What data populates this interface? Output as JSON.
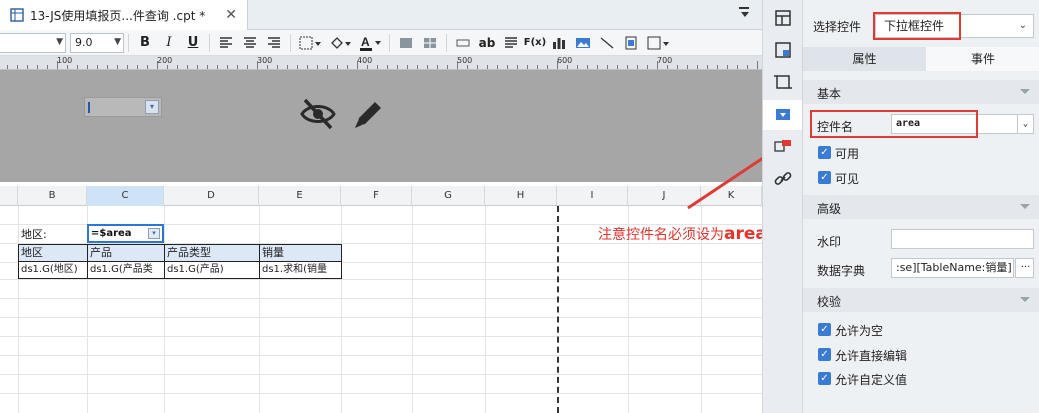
{
  "tab": {
    "title": "13-JS使用填报页...件查询 .cpt *",
    "close": "✕"
  },
  "toolbar": {
    "font_name": "",
    "font_size": "9.0",
    "bold": "B",
    "italic": "I",
    "underline": "U",
    "text_style": "ab",
    "formula": "F(x)"
  },
  "ruler": {
    "marks": [
      "100",
      "200",
      "300",
      "400",
      "500",
      "600",
      "700"
    ]
  },
  "columns": [
    "B",
    "C",
    "D",
    "E",
    "F",
    "G",
    "H",
    "I",
    "J",
    "K"
  ],
  "sheet": {
    "label_region": "地区:",
    "param_cell": "=$area",
    "headers": [
      "地区",
      "产品",
      "产品类型",
      "销量"
    ],
    "data_row": [
      "ds1.G(地区)",
      "ds1.G(产品类",
      "ds1.G(产品)",
      "ds1.求和(销量"
    ]
  },
  "annotation": {
    "text": "注意控件名必须设为",
    "highlight": "area",
    "color": "#e8322b"
  },
  "panel": {
    "select_label": "选择控件",
    "select_value": "下拉框控件",
    "tab_props": "属性",
    "tab_events": "事件",
    "section_basic": "基本",
    "widget_name_label": "控件名",
    "widget_name_value": "area",
    "enabled_label": "可用",
    "visible_label": "可见",
    "section_advanced": "高级",
    "watermark_label": "水印",
    "watermark_value": "",
    "dict_label": "数据字典",
    "dict_value": ":se][TableName:销量]",
    "dict_btn": "···",
    "section_validate": "校验",
    "allow_empty": "允许为空",
    "allow_edit": "允许直接编辑",
    "allow_custom": "允许自定义值"
  },
  "colors": {
    "accent": "#3a7bd5",
    "highlight_red": "#e03a33",
    "param_bg": "#a6a6a6"
  }
}
